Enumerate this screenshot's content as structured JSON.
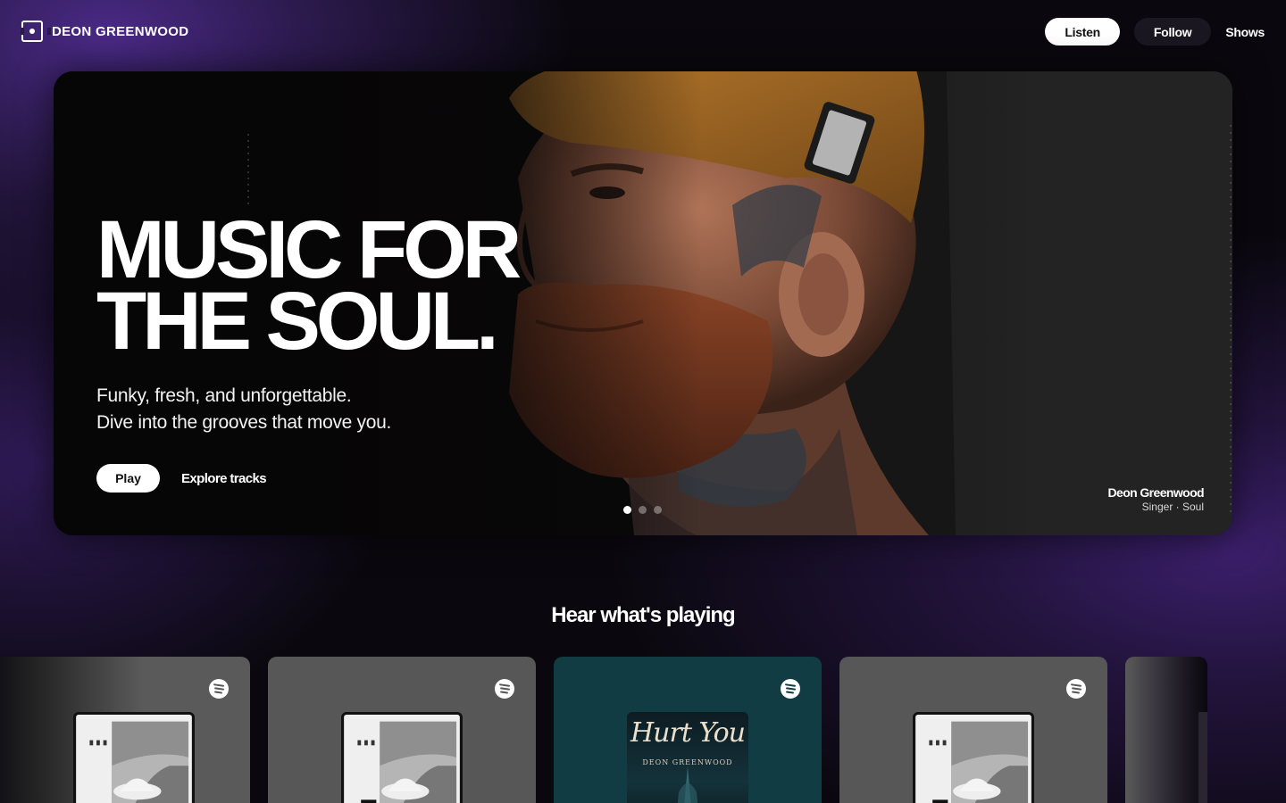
{
  "header": {
    "brand_name": "DEON GREENWOOD",
    "nav": {
      "listen": "Listen",
      "follow": "Follow",
      "shows": "Shows"
    }
  },
  "hero": {
    "title_line1": "MUSIC FOR",
    "title_line2": "THE SOUL.",
    "subtitle_line1": "Funky, fresh, and unforgettable.",
    "subtitle_line2": "Dive into the grooves that move you.",
    "play_label": "Play",
    "explore_label": "Explore tracks",
    "slides_count": 3,
    "active_slide": 1,
    "credit_name": "Deon Greenwood",
    "credit_role": "Singer · Soul"
  },
  "section": {
    "title": "Hear what's playing",
    "cards": [
      {
        "service_icon": "spotify-icon",
        "cover": "album-cover-road"
      },
      {
        "service_icon": "spotify-icon",
        "cover": "album-cover-road"
      },
      {
        "service_icon": "spotify-icon",
        "cover": "album-cover-hurt-you",
        "cover_title": "Hurt You",
        "cover_artist": "DEON GREENWOOD"
      },
      {
        "service_icon": "spotify-icon",
        "cover": "album-cover-road"
      },
      {
        "service_icon": "spotify-icon",
        "cover": "album-cover-partial"
      }
    ]
  },
  "colors": {
    "accent_purple": "#4a2a86",
    "background": "#0a080e",
    "card_gray": "#575757",
    "card_teal": "#113c43"
  }
}
